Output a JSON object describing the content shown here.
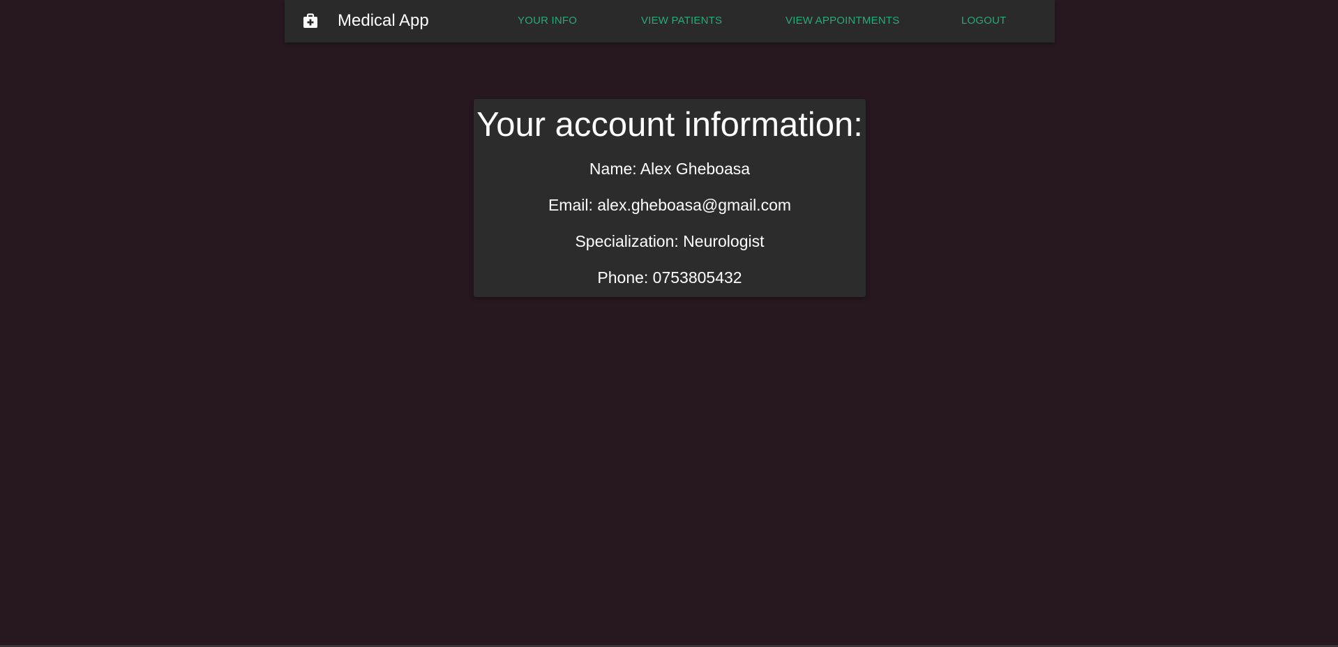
{
  "navbar": {
    "brand_icon": "medical-kit-icon",
    "title": "Medical App",
    "links": [
      {
        "label": "YOUR INFO"
      },
      {
        "label": "VIEW PATIENTS"
      },
      {
        "label": "VIEW APPOINTMENTS"
      },
      {
        "label": "LOGOUT"
      }
    ]
  },
  "account": {
    "heading": "Your account information:",
    "name": "Name: Alex Gheboasa",
    "email": "Email: alex.gheboasa@gmail.com",
    "specialization": "Specialization: Neurologist",
    "phone": "Phone: 0753805432"
  },
  "colors": {
    "background": "#27181f",
    "navbar": "#2a2a2a",
    "card": "#2c2c2c",
    "accent": "#2aa978",
    "text": "#ffffff"
  }
}
